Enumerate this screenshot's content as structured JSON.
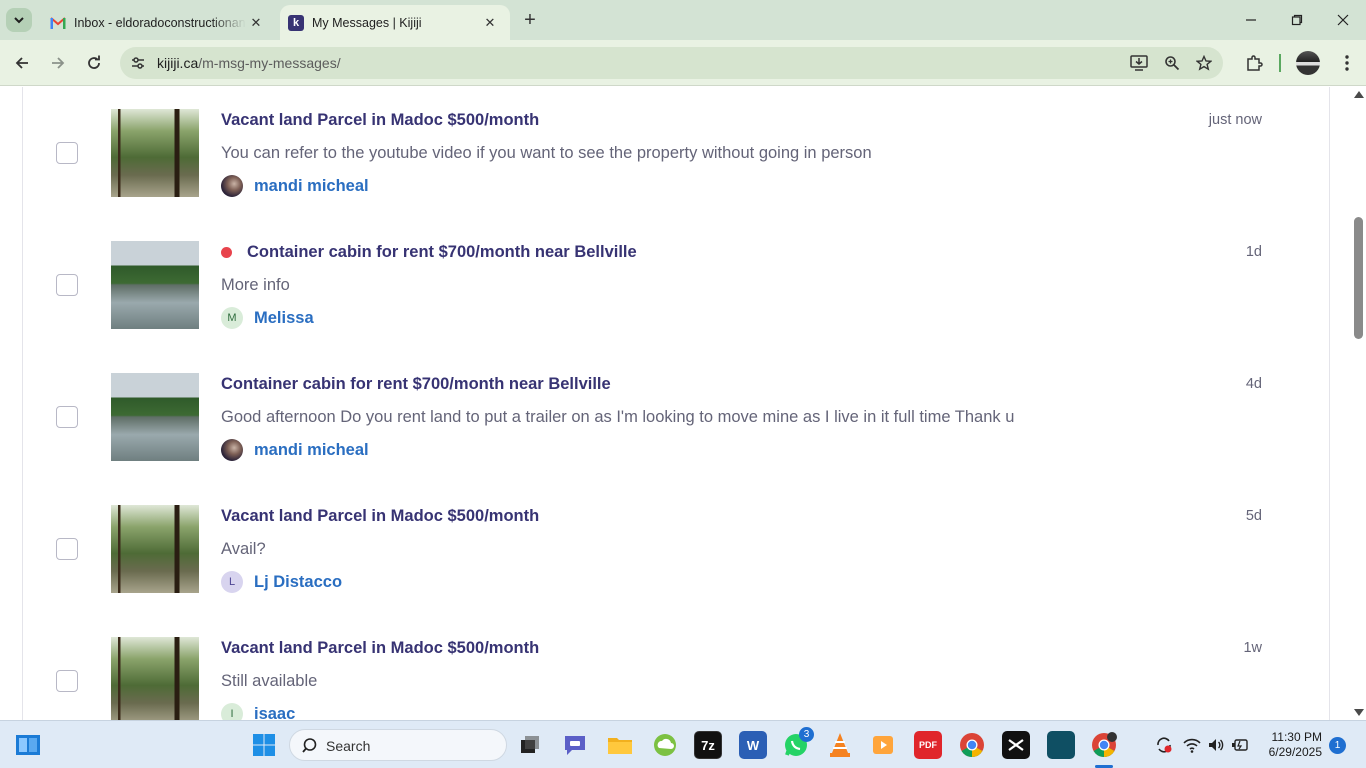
{
  "browser": {
    "tabs": [
      {
        "title": "Inbox - eldoradoconstructionan",
        "favicon": "gmail-icon",
        "active": false
      },
      {
        "title": "My Messages | Kijiji",
        "favicon": "kijiji-icon",
        "active": true
      }
    ],
    "url_host": "kijiji.ca",
    "url_path": "/m-msg-my-messages/"
  },
  "messages": [
    {
      "title": "Vacant land Parcel in Madoc $500/month",
      "preview": "You can refer to the youtube video if you want to see the property without going in person",
      "sender": "mandi micheal",
      "avatar_letter": "",
      "time": "just now",
      "unread": false
    },
    {
      "title": "Container cabin for rent $700/month near Bellville",
      "preview": "More info",
      "sender": "Melissa",
      "avatar_letter": "M",
      "time": "1d",
      "unread": true
    },
    {
      "title": "Container cabin for rent $700/month near Bellville",
      "preview": "Good afternoon Do you rent land to put a trailer on as I'm looking to move mine as I live in it full time Thank u",
      "sender": "mandi micheal",
      "avatar_letter": "",
      "time": "4d",
      "unread": false
    },
    {
      "title": "Vacant land Parcel in Madoc $500/month",
      "preview": "Avail?",
      "sender": "Lj Distacco",
      "avatar_letter": "L",
      "time": "5d",
      "unread": false
    },
    {
      "title": "Vacant land Parcel in Madoc $500/month",
      "preview": "Still available",
      "sender": "isaac",
      "avatar_letter": "I",
      "time": "1w",
      "unread": false
    }
  ],
  "taskbar": {
    "search_label": "Search",
    "whatsapp_badge": "3",
    "time": "11:30 PM",
    "date": "6/29/2025",
    "notification_count": "1"
  },
  "colors": {
    "title_text": "#373373",
    "link_blue": "#2a6ec1",
    "unread_dot": "#e8434c",
    "chrome_frame": "#d3e3d4"
  }
}
